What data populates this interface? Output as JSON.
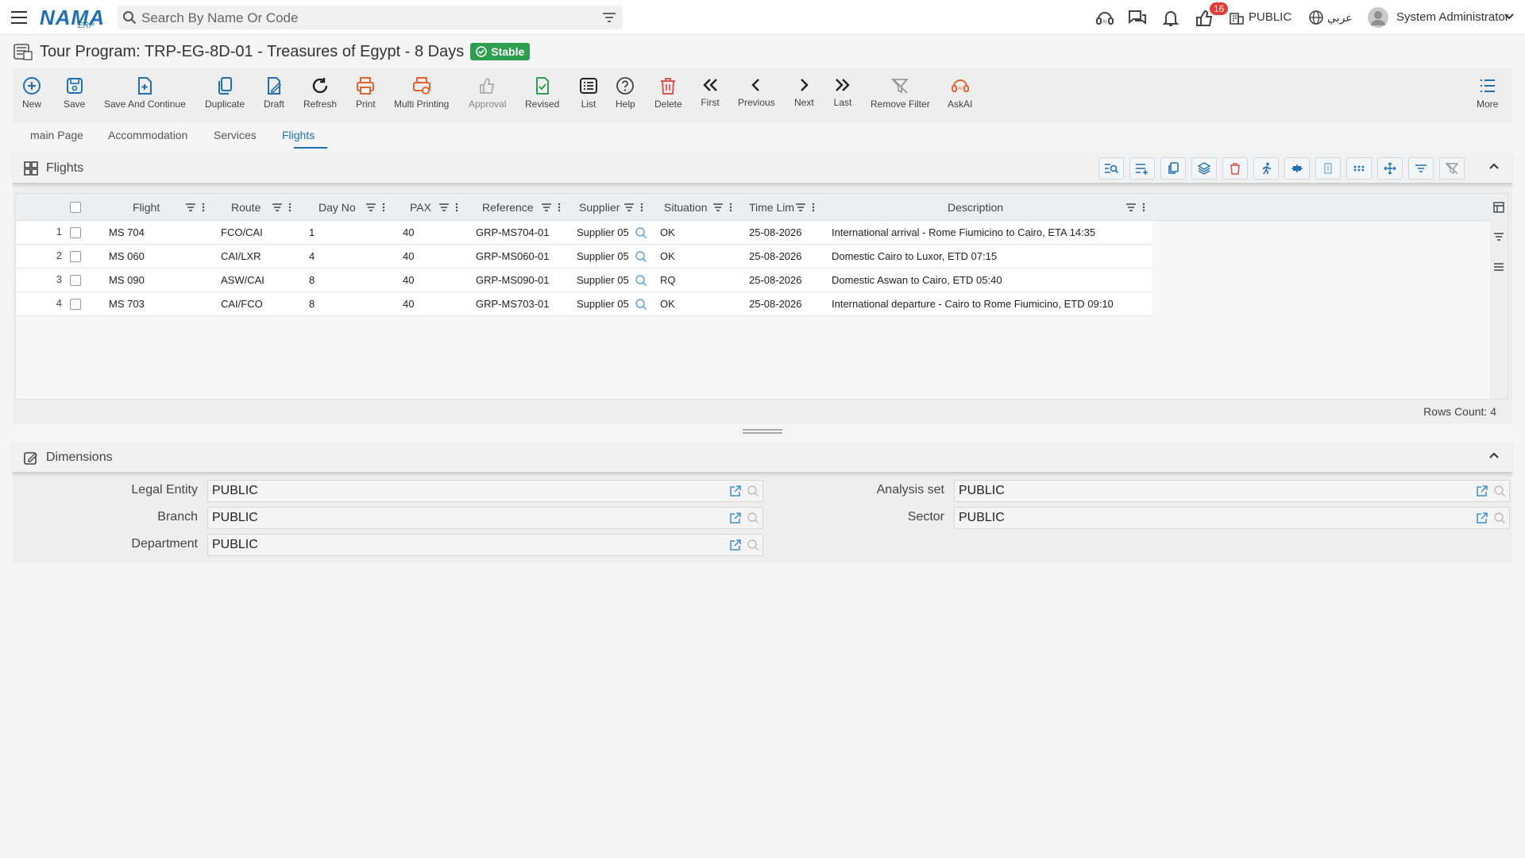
{
  "topbar": {
    "logo_text": "NAMA",
    "logo_sub": "ERP",
    "search_placeholder": "Search By Name Or Code",
    "notification_count": "16",
    "company": "PUBLIC",
    "language": "عربي",
    "user_name": "System Administrator"
  },
  "page": {
    "title": "Tour Program: TRP-EG-8D-01 - Treasures of Egypt - 8 Days",
    "status": "Stable"
  },
  "toolbar": {
    "new": "New",
    "save": "Save",
    "save_continue": "Save And Continue",
    "duplicate": "Duplicate",
    "draft": "Draft",
    "refresh": "Refresh",
    "print": "Print",
    "multi_printing": "Multi Printing",
    "approval": "Approval",
    "revised": "Revised",
    "list": "List",
    "help": "Help",
    "delete": "Delete",
    "first": "First",
    "previous": "Previous",
    "next": "Next",
    "last": "Last",
    "remove_filter": "Remove Filter",
    "askai": "AskAI",
    "more": "More"
  },
  "tabs": [
    "main Page",
    "Accommodation",
    "Services",
    "Flights"
  ],
  "flights": {
    "title": "Flights",
    "columns": {
      "flight": "Flight",
      "route": "Route",
      "day_no": "Day No",
      "pax": "PAX",
      "reference": "Reference",
      "supplier": "Supplier",
      "situation": "Situation",
      "time_limit": "Time Lim",
      "description": "Description"
    },
    "rows": [
      {
        "num": "1",
        "flight": "MS 704",
        "route": "FCO/CAI",
        "day": "1",
        "pax": "40",
        "ref": "GRP-MS704-01",
        "supplier": "Supplier 05",
        "situation": "OK",
        "time": "25-08-2026",
        "desc": "International arrival - Rome Fiumicino to Cairo, ETA 14:35"
      },
      {
        "num": "2",
        "flight": "MS 060",
        "route": "CAI/LXR",
        "day": "4",
        "pax": "40",
        "ref": "GRP-MS060-01",
        "supplier": "Supplier 05",
        "situation": "OK",
        "time": "25-08-2026",
        "desc": "Domestic Cairo to Luxor, ETD 07:15"
      },
      {
        "num": "3",
        "flight": "MS 090",
        "route": "ASW/CAI",
        "day": "8",
        "pax": "40",
        "ref": "GRP-MS090-01",
        "supplier": "Supplier 05",
        "situation": "RQ",
        "time": "25-08-2026",
        "desc": "Domestic Aswan to Cairo, ETD 05:40"
      },
      {
        "num": "4",
        "flight": "MS 703",
        "route": "CAI/FCO",
        "day": "8",
        "pax": "40",
        "ref": "GRP-MS703-01",
        "supplier": "Supplier 05",
        "situation": "OK",
        "time": "25-08-2026",
        "desc": "International departure - Cairo to Rome Fiumicino, ETD 09:10"
      }
    ],
    "rows_count": "Rows Count: 4"
  },
  "dimensions": {
    "title": "Dimensions",
    "legal_entity_label": "Legal Entity",
    "legal_entity_value": "PUBLIC",
    "branch_label": "Branch",
    "branch_value": "PUBLIC",
    "department_label": "Department",
    "department_value": "PUBLIC",
    "analysis_set_label": "Analysis set",
    "analysis_set_value": "PUBLIC",
    "sector_label": "Sector",
    "sector_value": "PUBLIC"
  },
  "colors": {
    "accent": "#1f6fb8",
    "status_green": "#2e9e4f",
    "print_orange": "#e8622c",
    "delete_red": "#d9534f"
  }
}
